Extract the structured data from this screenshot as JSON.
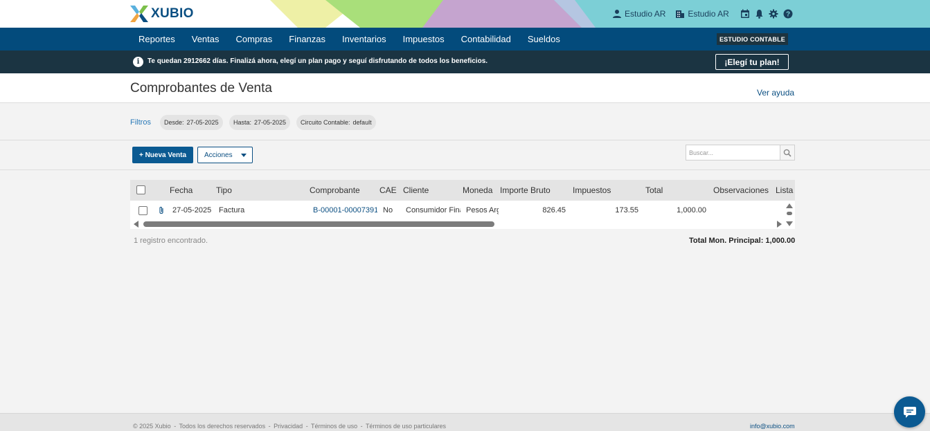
{
  "brand": {
    "name": "XUBIO"
  },
  "header": {
    "user_label": "Estudio AR",
    "company_label": "Estudio AR",
    "icons": [
      "calendar-icon",
      "bell-icon",
      "gear-icon",
      "help-icon"
    ]
  },
  "nav": {
    "items": [
      "Reportes",
      "Ventas",
      "Compras",
      "Finanzas",
      "Inventarios",
      "Impuestos",
      "Contabilidad",
      "Sueldos"
    ],
    "badge": "ESTUDIO CONTABLE"
  },
  "banner": {
    "text": "Te quedan 2912662 días. Finalizá ahora, elegí un plan pago y seguí disfrutando de todos los beneficios.",
    "button": "¡Elegí tu plan!"
  },
  "page": {
    "title": "Comprobantes de Venta",
    "help": "Ver ayuda"
  },
  "filters": {
    "label": "Filtros",
    "chips": [
      {
        "key": "Desde:",
        "value": "27-05-2025"
      },
      {
        "key": "Hasta:",
        "value": "27-05-2025"
      },
      {
        "key": "Circuito Contable:",
        "value": "default"
      }
    ]
  },
  "toolbar": {
    "new_sale": "+ Nueva Venta",
    "actions": "Acciones",
    "search_placeholder": "Buscar..."
  },
  "table": {
    "columns": [
      "Fecha",
      "Tipo",
      "Comprobante",
      "CAE",
      "Cliente",
      "Moneda",
      "Importe Bruto",
      "Impuestos",
      "Total",
      "Observaciones",
      "Lista"
    ],
    "rows": [
      {
        "fecha": "27-05-2025",
        "tipo": "Factura",
        "comprobante": "B-00001-00007391",
        "cae": "No",
        "cliente": "Consumidor Final",
        "moneda": "Pesos Argentinos",
        "importe_bruto": "826.45",
        "impuestos": "173.55",
        "total": "1,000.00",
        "observaciones": ""
      }
    ]
  },
  "summary": {
    "records": "1 registro encontrado.",
    "total": "Total Mon. Principal: 1,000.00"
  },
  "footer": {
    "copyright": "© 2025 Xubio",
    "links": [
      "Todos los derechos reservados",
      "Privacidad",
      "Términos de uso",
      "Términos de uso particulares"
    ],
    "separator": "-",
    "email": "info@xubio.com"
  },
  "colors": {
    "primary": "#034b7c",
    "banner": "#1b3442",
    "accent_green": "#a9df7a",
    "accent_teal": "#7ccfd6",
    "accent_purple": "#c5a4cf",
    "accent_yellow": "#eef0a6"
  }
}
